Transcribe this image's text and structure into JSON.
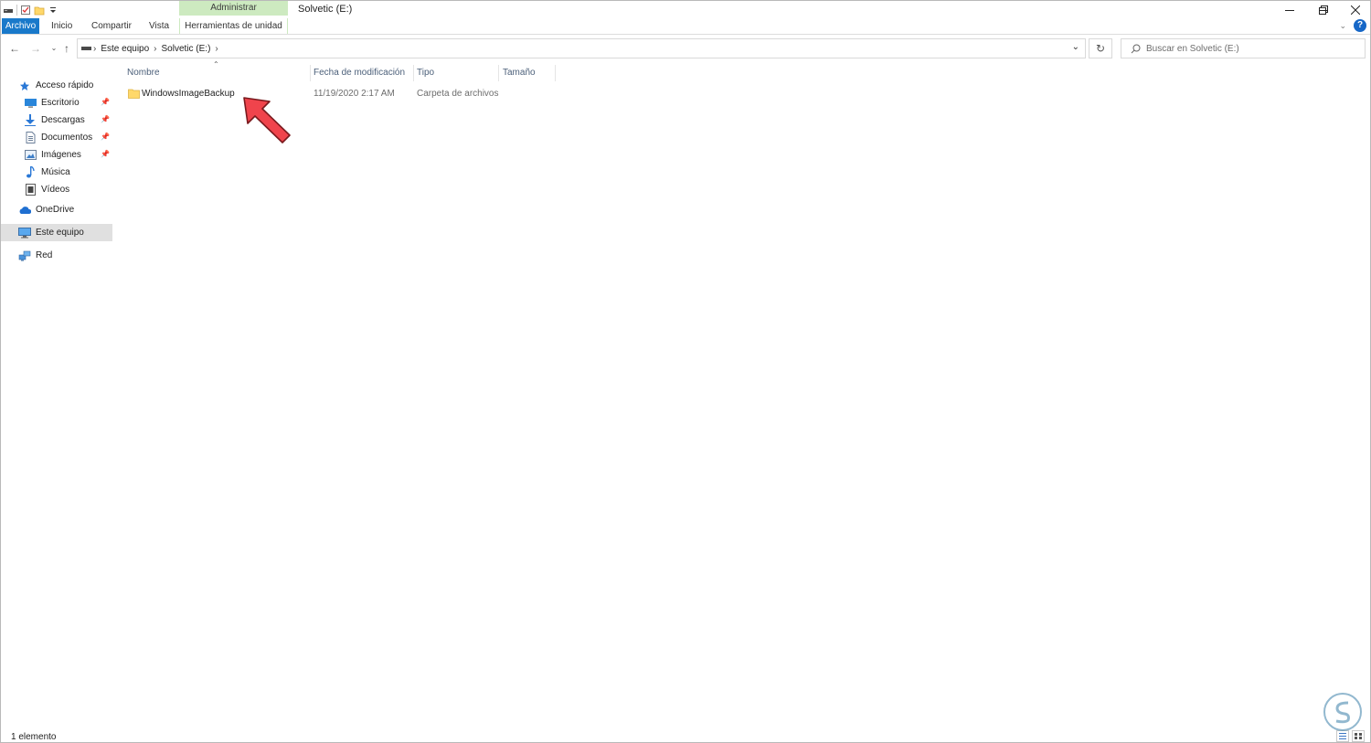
{
  "window": {
    "title": "Solvetic (E:)",
    "controls": [
      "minimize",
      "restore",
      "close"
    ]
  },
  "quick_access_toolbar": [
    "drive-icon",
    "properties-icon",
    "new-folder-icon",
    "customize-dropdown-icon"
  ],
  "ribbon": {
    "contextual_header": "Administrar",
    "tabs": [
      {
        "label": "Archivo"
      },
      {
        "label": "Inicio"
      },
      {
        "label": "Compartir"
      },
      {
        "label": "Vista"
      },
      {
        "label": "Herramientas de unidad"
      }
    ]
  },
  "address_bar": {
    "crumbs": [
      "Este equipo",
      "Solvetic (E:)"
    ]
  },
  "search": {
    "placeholder": "Buscar en Solvetic (E:)"
  },
  "sidebar": {
    "items": [
      {
        "label": "Acceso rápido",
        "icon": "star-icon"
      },
      {
        "label": "Escritorio",
        "icon": "desktop-icon",
        "pinned": true
      },
      {
        "label": "Descargas",
        "icon": "download-icon",
        "pinned": true
      },
      {
        "label": "Documentos",
        "icon": "document-icon",
        "pinned": true
      },
      {
        "label": "Imágenes",
        "icon": "pictures-icon",
        "pinned": true
      },
      {
        "label": "Música",
        "icon": "music-icon"
      },
      {
        "label": "Vídeos",
        "icon": "video-icon"
      },
      {
        "label": "OneDrive",
        "icon": "cloud-icon"
      },
      {
        "label": "Este equipo",
        "icon": "computer-icon",
        "selected": true
      },
      {
        "label": "Red",
        "icon": "network-icon"
      }
    ]
  },
  "columns": [
    "Nombre",
    "Fecha de modificación",
    "Tipo",
    "Tamaño"
  ],
  "files": [
    {
      "name": "WindowsImageBackup",
      "modified": "11/19/2020 2:17 AM",
      "type": "Carpeta de archivos",
      "size": ""
    }
  ],
  "status": {
    "count_text": "1 elemento"
  },
  "colors": {
    "file_tab": "#1979ca",
    "contextual_tab": "#cdeac0",
    "selection": "#e0e0e0",
    "annotation_arrow": "#f0444c",
    "folder": "#ffd86a"
  }
}
